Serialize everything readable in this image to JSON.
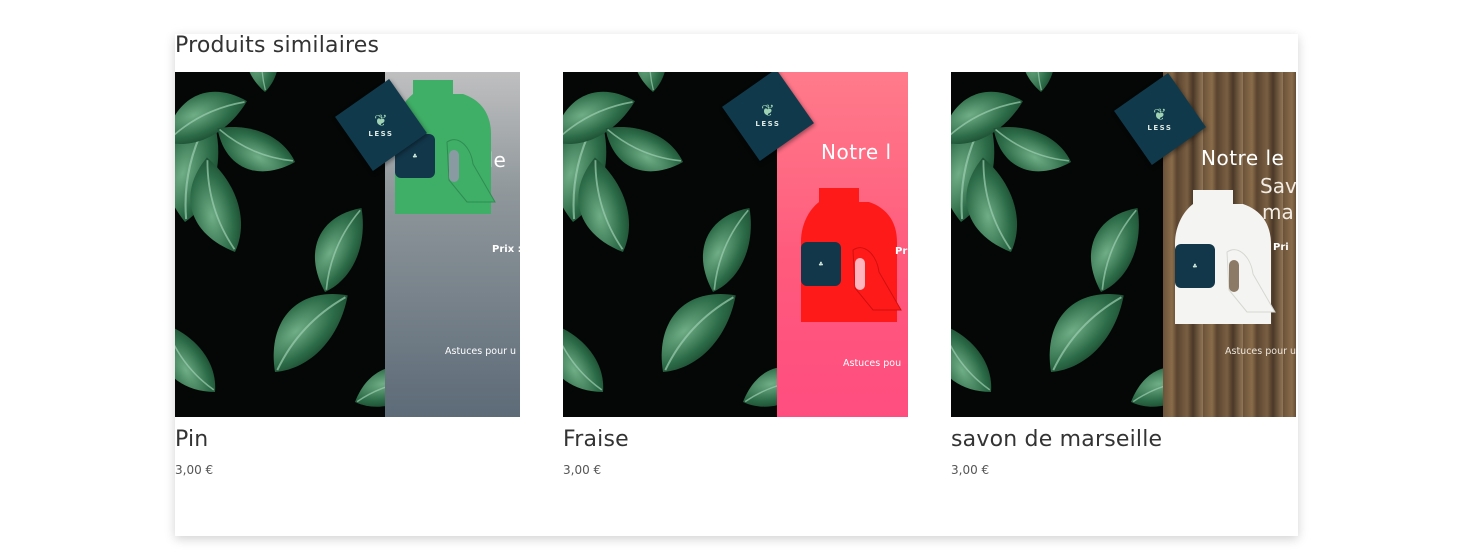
{
  "section": {
    "title": "Produits similaires"
  },
  "poster": {
    "brand": "LESS",
    "heading_cropped": "Notre le",
    "heading_cropped_short": "Notre l",
    "line2_cropped": "Sav",
    "line3_cropped": "ma",
    "price_cropped": "Prix :",
    "price_cropped_short": "Pri",
    "tips_cropped": "Astuces pour u",
    "tips_cropped_short": "Astuces pou",
    "tips_cropped_3": "Astuces pour u"
  },
  "colors": {
    "pin_bottle": "#3fae66",
    "fraise_bottle": "#ff1a1a",
    "marseille_bottle": "#f4f4f2",
    "badge": "#103a4c"
  },
  "products": [
    {
      "name": "Pin",
      "price": "3,00 €"
    },
    {
      "name": "Fraise",
      "price": "3,00 €"
    },
    {
      "name": "savon de marseille",
      "price": "3,00 €"
    }
  ]
}
